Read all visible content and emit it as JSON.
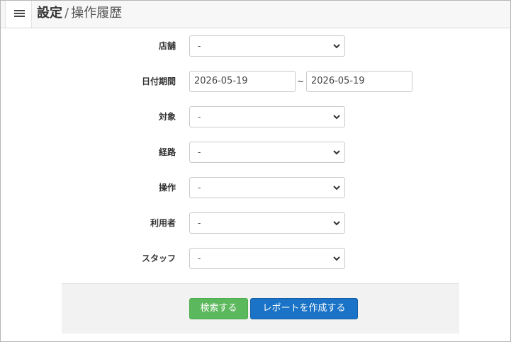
{
  "header": {
    "menu_icon": "hamburger-menu-icon",
    "title_main": "設定",
    "separator": "/",
    "title_sub": "操作履歴"
  },
  "form": {
    "store": {
      "label": "店舗",
      "value": "-"
    },
    "date_range": {
      "label": "日付期間",
      "from": "2026-05-19",
      "separator": "~",
      "to": "2026-05-19"
    },
    "target": {
      "label": "対象",
      "value": "-"
    },
    "route": {
      "label": "経路",
      "value": "-"
    },
    "operation": {
      "label": "操作",
      "value": "-"
    },
    "user": {
      "label": "利用者",
      "value": "-"
    },
    "staff": {
      "label": "スタッフ",
      "value": "-"
    }
  },
  "actions": {
    "search_label": "検索する",
    "report_label": "レポートを作成する"
  },
  "colors": {
    "search_button": "#5cb85c",
    "report_button": "#1a73c6",
    "footer_panel": "#f2f2f2"
  }
}
